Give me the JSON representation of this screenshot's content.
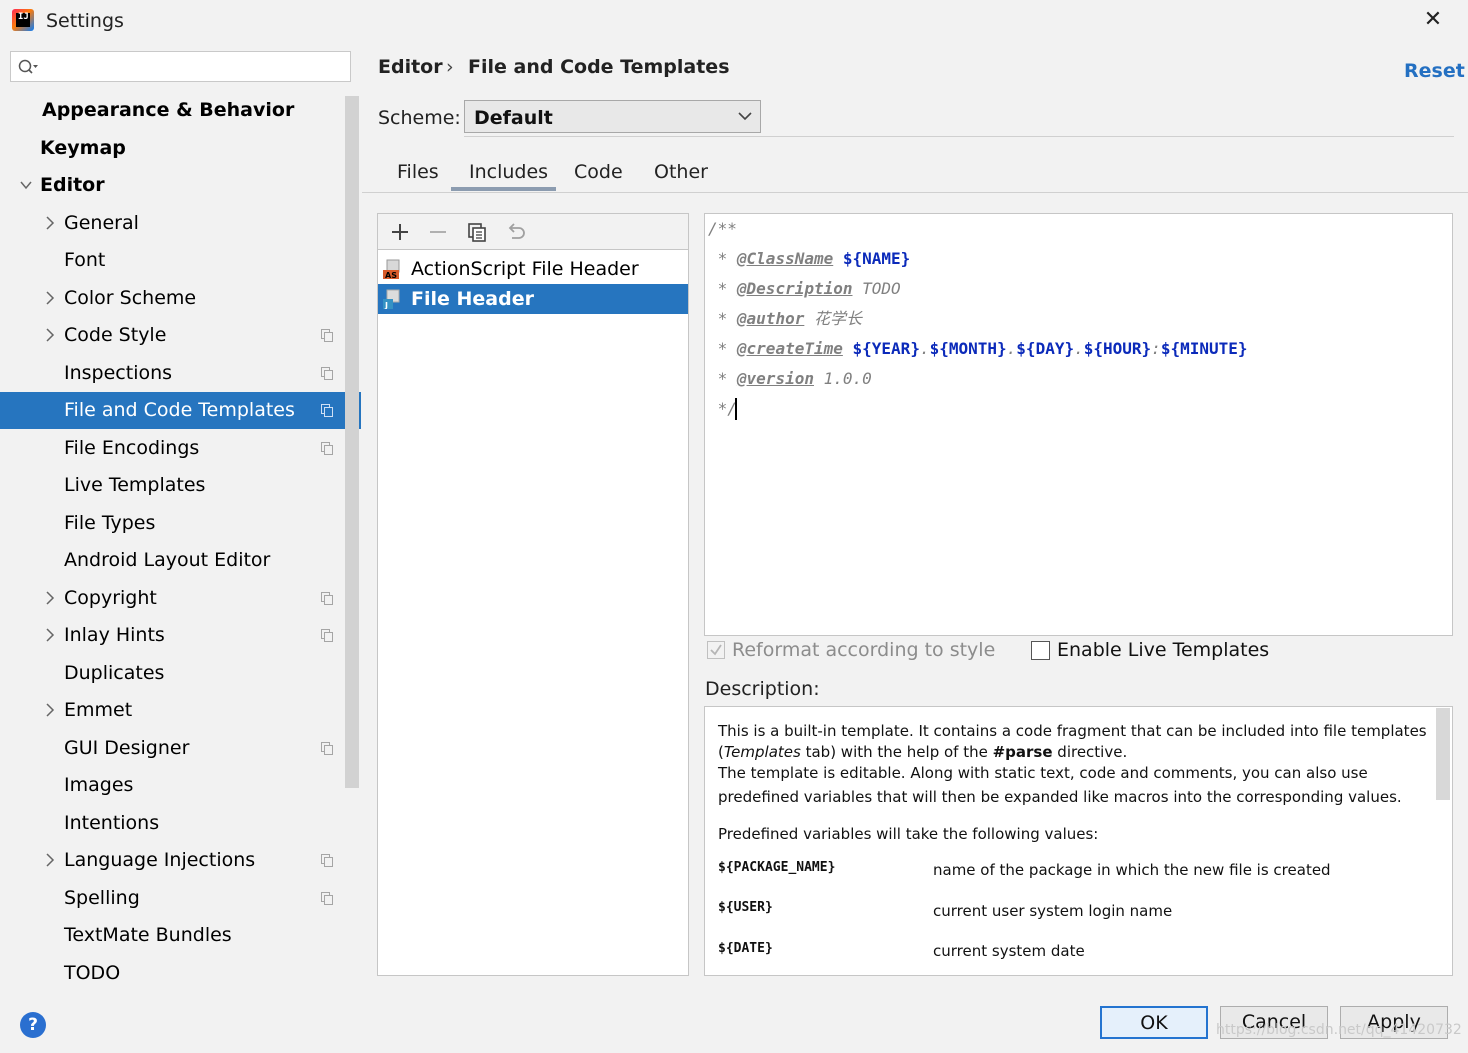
{
  "window": {
    "title": "Settings",
    "close_symbol": "✕"
  },
  "sidebar": {
    "search_placeholder": "",
    "items": [
      {
        "label": "Appearance & Behavior",
        "bold": true
      },
      {
        "label": "Keymap",
        "bold": true
      },
      {
        "label": "Editor",
        "bold": true,
        "expanded": true
      },
      {
        "label": "General",
        "has_children": true
      },
      {
        "label": "Font"
      },
      {
        "label": "Color Scheme",
        "has_children": true
      },
      {
        "label": "Code Style",
        "has_children": true,
        "project_icon": true
      },
      {
        "label": "Inspections",
        "project_icon": true
      },
      {
        "label": "File and Code Templates",
        "project_icon": true,
        "selected": true
      },
      {
        "label": "File Encodings",
        "project_icon": true
      },
      {
        "label": "Live Templates"
      },
      {
        "label": "File Types"
      },
      {
        "label": "Android Layout Editor"
      },
      {
        "label": "Copyright",
        "has_children": true,
        "project_icon": true
      },
      {
        "label": "Inlay Hints",
        "has_children": true,
        "project_icon": true
      },
      {
        "label": "Duplicates"
      },
      {
        "label": "Emmet",
        "has_children": true
      },
      {
        "label": "GUI Designer",
        "project_icon": true
      },
      {
        "label": "Images"
      },
      {
        "label": "Intentions"
      },
      {
        "label": "Language Injections",
        "has_children": true,
        "project_icon": true
      },
      {
        "label": "Spelling",
        "project_icon": true
      },
      {
        "label": "TextMate Bundles"
      },
      {
        "label": "TODO"
      }
    ]
  },
  "header": {
    "breadcrumb_root": "Editor",
    "breadcrumb_sep": "›",
    "breadcrumb_page": "File and Code Templates",
    "reset_label": "Reset"
  },
  "scheme": {
    "label": "Scheme:",
    "value": "Default"
  },
  "tabs": [
    {
      "label": "Files"
    },
    {
      "label": "Includes",
      "active": true
    },
    {
      "label": "Code"
    },
    {
      "label": "Other"
    }
  ],
  "template_list": {
    "toolbar_icons": [
      "add-icon",
      "remove-icon",
      "copy-icon",
      "revert-icon"
    ],
    "items": [
      {
        "label": "ActionScript File Header",
        "icon": "actionscript-file-icon"
      },
      {
        "label": "File Header",
        "icon": "java-file-icon",
        "selected": true
      }
    ]
  },
  "editor": {
    "lines": {
      "l1": "/**",
      "l2_star": "* ",
      "l2_tag": "@ClassName",
      "l2_var": "${NAME}",
      "l3_star": "* ",
      "l3_tag": "@Description",
      "l3_text": "TODO",
      "l4_star": "* ",
      "l4_tag": "@author",
      "l4_text": "花学长",
      "l5_star": "* ",
      "l5_tag": "@createTime",
      "l5_year": "${YEAR}",
      "l5_month": "${MONTH}",
      "l5_day": "${DAY}",
      "l5_hour": "${HOUR}",
      "l5_minute": "${MINUTE}",
      "l5_dot": ".",
      "l5_colon": ":",
      "l6_star": "* ",
      "l6_tag": "@version",
      "l6_text": "1.0.0",
      "l7": "*/"
    }
  },
  "options": {
    "reformat_label": "Reformat according to style",
    "reformat_checked": true,
    "reformat_disabled": true,
    "live_templates_label": "Enable Live Templates",
    "live_templates_checked": false
  },
  "description": {
    "title": "Description:",
    "p1_a": "This is a built-in template. It contains a code fragment that can be included into file templates",
    "p1_b_pre": "(",
    "p1_b_em": "Templates",
    "p1_b_mid": " tab) with the help of the ",
    "p1_b_strong": "#parse",
    "p1_b_post": " directive.",
    "p2_a": "The template is editable. Along with static text, code and comments, you can also use",
    "p2_b": "predefined variables that will then be expanded like macros into the corresponding values.",
    "p3": "Predefined variables will take the following values:",
    "variables": [
      {
        "name": "${PACKAGE_NAME}",
        "desc": "name of the package in which the new file is created"
      },
      {
        "name": "${USER}",
        "desc": "current user system login name"
      },
      {
        "name": "${DATE}",
        "desc": "current system date"
      }
    ]
  },
  "footer": {
    "help_symbol": "?",
    "ok_label": "OK",
    "cancel_label": "Cancel",
    "apply_label": "Apply",
    "watermark": "https://blog.csdn.net/qq_41420732"
  },
  "colors": {
    "selection": "#2675bf",
    "link": "#2470c2",
    "variable": "#0b2aba"
  }
}
